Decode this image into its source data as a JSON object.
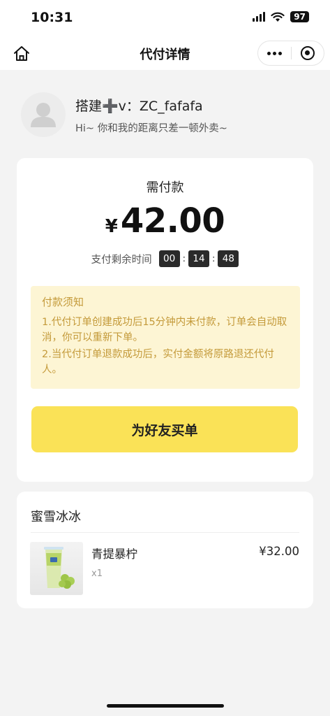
{
  "status_bar": {
    "time": "10:31",
    "battery": "97"
  },
  "nav": {
    "title": "代付详情"
  },
  "requester": {
    "name": "搭建➕v：ZC_fafafa",
    "message": "Hi~ 你和我的距离只差一顿外卖~"
  },
  "payment": {
    "label": "需付款",
    "currency": "¥",
    "amount": "42.00",
    "countdown_label": "支付剩余时间",
    "countdown": {
      "hours": "00",
      "minutes": "14",
      "seconds": "48"
    }
  },
  "notice": {
    "title": "付款须知",
    "items": [
      "1.代付订单创建成功后15分钟内未付款，订单会自动取消，你可以重新下单。",
      "2.当代付订单退款成功后，实付金额将原路退还代付人。"
    ]
  },
  "action": {
    "buy_label": "为好友买单"
  },
  "order": {
    "store": "蜜雪冰冰",
    "items": [
      {
        "name": "青提暴柠",
        "price": "¥32.00",
        "qty": "x1"
      }
    ]
  },
  "colors": {
    "accent": "#fae257",
    "notice_bg": "#fdf5d4",
    "notice_text": "#c49a3a"
  }
}
